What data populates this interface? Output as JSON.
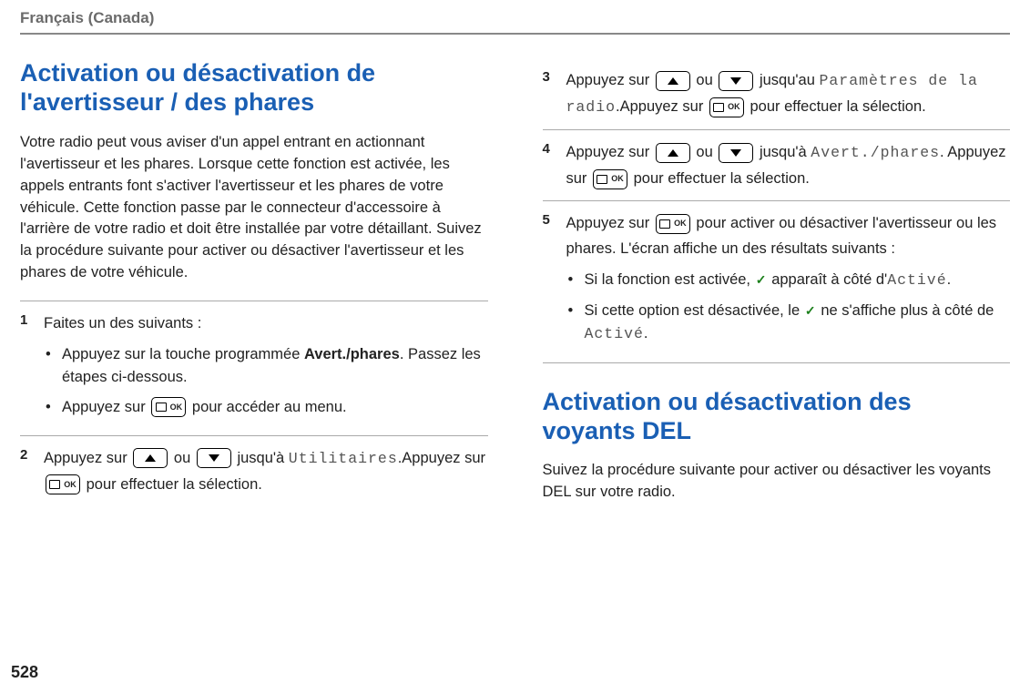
{
  "lang_header": "Français (Canada)",
  "page_number": "528",
  "left": {
    "title": "Activation ou désactivation de l'avertisseur / des phares",
    "intro": "Votre radio peut vous aviser d'un appel entrant en actionnant l'avertisseur et les phares. Lorsque cette fonction est activée, les appels entrants font s'activer l'avertisseur et les phares de votre véhicule. Cette fonction passe par le connecteur d'accessoire à l'arrière de votre radio et doit être installée par votre détaillant. Suivez la procédure suivante pour activer ou désactiver l'avertisseur et les phares de votre véhicule.",
    "step1": {
      "num": "1",
      "lead": "Faites un des suivants :",
      "b1a": "Appuyez sur la touche programmée ",
      "b1b_bold": "Avert./phares",
      "b1c": ". Passez les étapes ci-dessous.",
      "b2a": "Appuyez sur ",
      "b2b": " pour accéder au menu."
    },
    "step2": {
      "num": "2",
      "t1": "Appuyez sur ",
      "t2": " ou ",
      "t3": " jusqu'à ",
      "mono1": "Utilitaires",
      "t4": ".Appuyez sur ",
      "t5": " pour effectuer la sélection."
    }
  },
  "right": {
    "step3": {
      "num": "3",
      "t1": "Appuyez sur ",
      "t2": " ou ",
      "t3": " jusqu'au ",
      "mono1": "Paramètres de la radio",
      "t4": ".Appuyez sur ",
      "t5": " pour effectuer la sélection."
    },
    "step4": {
      "num": "4",
      "t1": "Appuyez sur ",
      "t2": " ou ",
      "t3": " jusqu'à ",
      "mono1": "Avert./phares",
      "t4": ". Appuyez sur ",
      "t5": " pour effectuer la sélection."
    },
    "step5": {
      "num": "5",
      "t1": "Appuyez sur ",
      "t2": " pour activer ou désactiver l'avertisseur ou les phares. L'écran affiche un des résultats suivants :",
      "b1a": "Si la fonction est activée, ",
      "b1b": " apparaît à côté d'",
      "b1c_mono": "Activé",
      "b1d": ".",
      "b2a": "Si cette option est désactivée, le ",
      "b2b": " ne s'affiche plus à côté de ",
      "b2c_mono": "Activé",
      "b2d": "."
    },
    "title2": "Activation ou désactivation des voyants DEL",
    "intro2": "Suivez la procédure suivante pour activer ou désactiver les voyants DEL sur votre radio."
  }
}
